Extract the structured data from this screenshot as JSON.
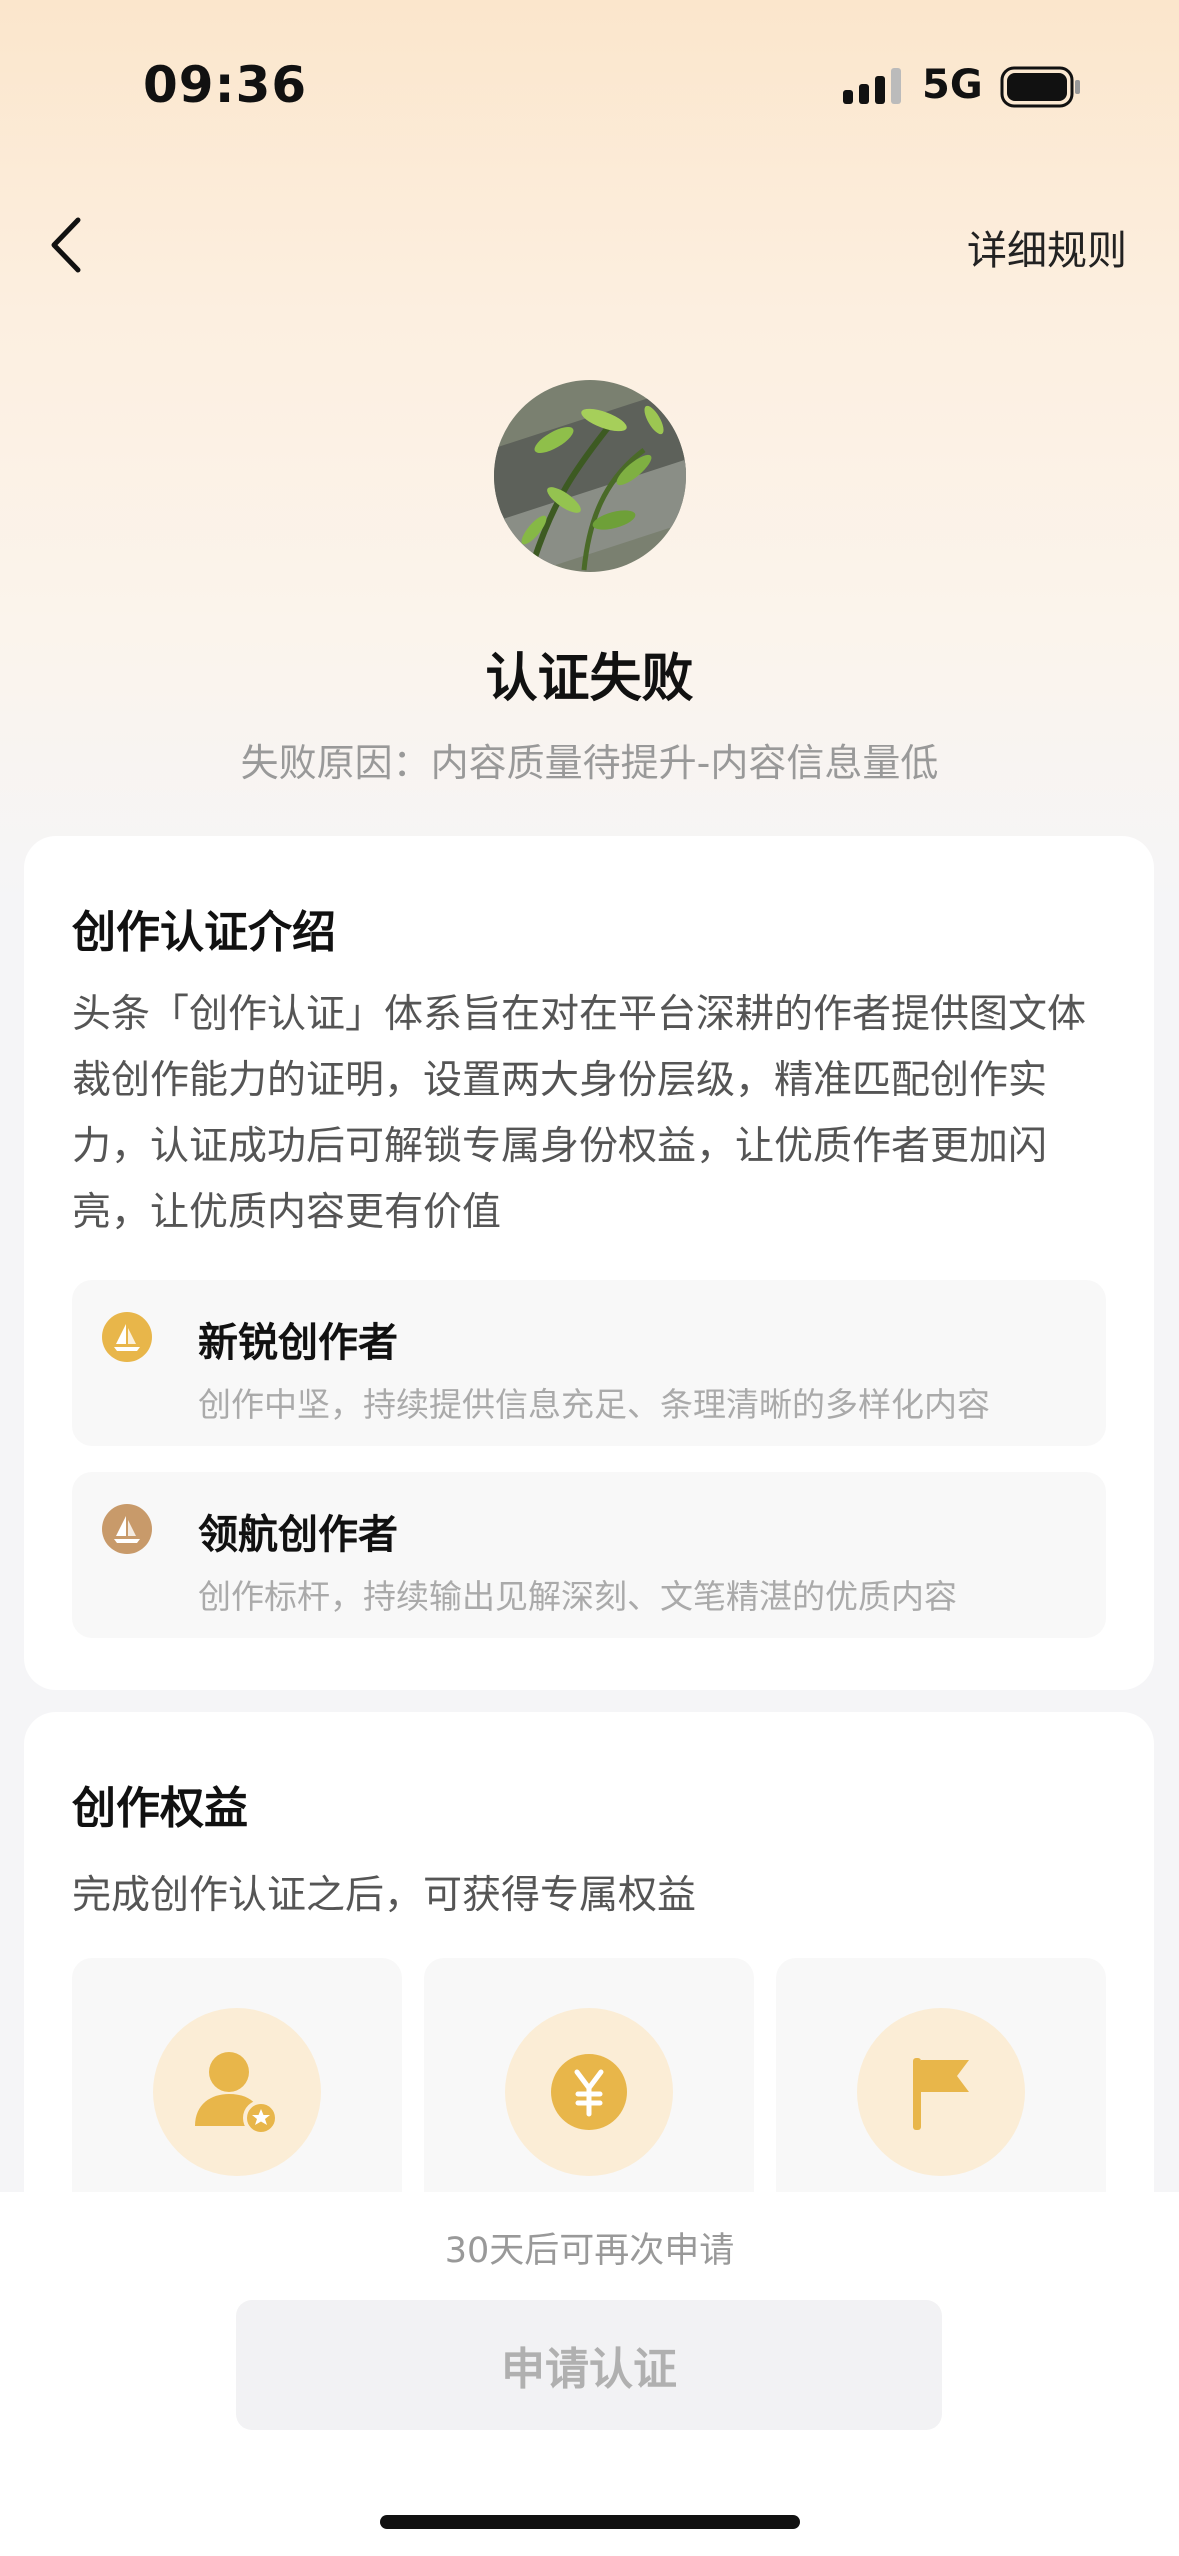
{
  "status_bar": {
    "time": "09:36",
    "network": "5G",
    "signal_icon": "signal-bars-icon",
    "battery_icon": "battery-icon"
  },
  "nav": {
    "back_icon": "chevron-left-icon",
    "rules_label": "详细规则"
  },
  "result": {
    "title": "认证失败",
    "reason": "失败原因：内容质量待提升-内容信息量低"
  },
  "intro_card": {
    "title": "创作认证介绍",
    "description": "头条「创作认证」体系旨在对在平台深耕的作者提供图文体裁创作能力的证明，设置两大身份层级，精准匹配创作实力，认证成功后可解锁专属身份权益，让优质作者更加闪亮，让优质内容更有价值",
    "levels": [
      {
        "name": "新锐创作者",
        "desc": "创作中坚，持续提供信息充足、条理清晰的多样化内容",
        "icon": "sailboat-gold-icon"
      },
      {
        "name": "领航创作者",
        "desc": "创作标杆，持续输出见解深刻、文笔精湛的优质内容",
        "icon": "sailboat-bronze-icon"
      }
    ]
  },
  "rights_card": {
    "title": "创作权益",
    "subtitle": "完成创作认证之后，可获得专属权益",
    "items": [
      {
        "icon": "user-star-icon"
      },
      {
        "icon": "yuan-coin-icon"
      },
      {
        "icon": "flag-icon"
      }
    ]
  },
  "bottom": {
    "note": "30天后可再次申请",
    "apply_label": "申请认证"
  },
  "colors": {
    "accent_gold": "#e8b64a",
    "bronze": "#c89a6a",
    "icon_circle": "#fbedd6",
    "header_gradient_top": "#fbe6cc"
  }
}
